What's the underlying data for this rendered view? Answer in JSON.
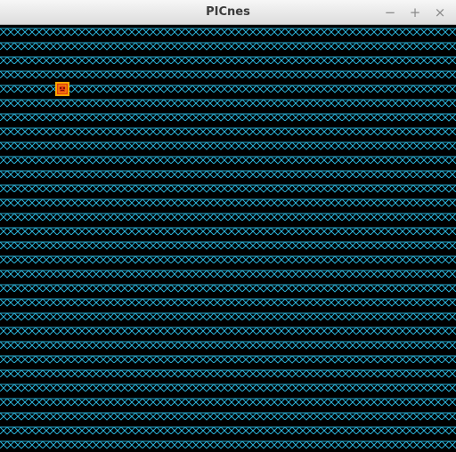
{
  "window": {
    "title": "PICnes",
    "controls": {
      "minimize_glyph": "−",
      "maximize_glyph": "+",
      "close_glyph": "×"
    }
  },
  "screen": {
    "background_color": "#000000",
    "pattern_color": "#29a8cc"
  },
  "sprite": {
    "icon": "sprite-face-icon",
    "fill_color": "#e23a10",
    "border_color": "#f7a600"
  }
}
